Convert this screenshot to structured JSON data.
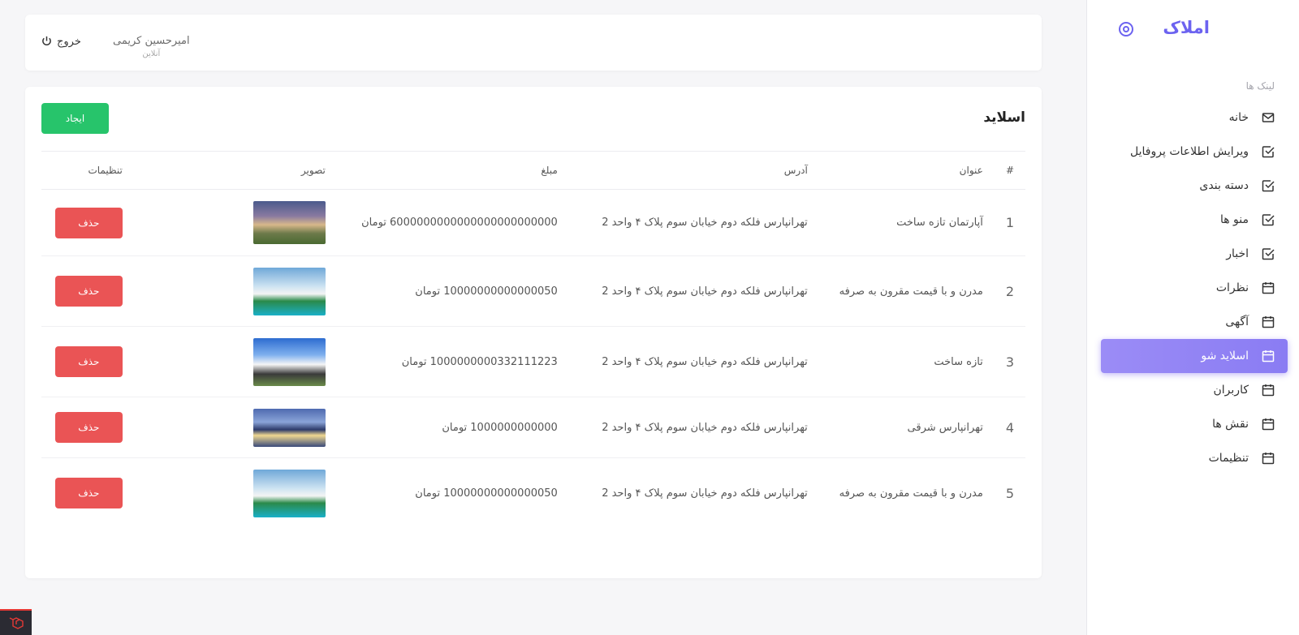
{
  "brand": {
    "title": "املاک"
  },
  "sidebar": {
    "section_label": "لینک ها",
    "items": [
      {
        "label": "خانه",
        "icon": "mail-icon"
      },
      {
        "label": "ویرایش اطلاعات پروفایل",
        "icon": "check-square-icon"
      },
      {
        "label": "دسته بندی",
        "icon": "check-square-icon"
      },
      {
        "label": "منو ها",
        "icon": "check-square-icon"
      },
      {
        "label": "اخبار",
        "icon": "check-square-icon"
      },
      {
        "label": "نظرات",
        "icon": "calendar-icon"
      },
      {
        "label": "آگهی",
        "icon": "calendar-icon"
      },
      {
        "label": "اسلاید شو",
        "icon": "calendar-icon",
        "active": true
      },
      {
        "label": "کاربران",
        "icon": "calendar-icon"
      },
      {
        "label": "نقش ها",
        "icon": "calendar-icon"
      },
      {
        "label": "تنظیمات",
        "icon": "calendar-icon"
      }
    ],
    "active_color": "#8a7cf3"
  },
  "topbar": {
    "logout_label": "خروج",
    "user_name": "امیرحسین کریمی",
    "user_status": "آنلاین"
  },
  "card": {
    "title": "اسلاید",
    "create_label": "ایجاد"
  },
  "table": {
    "headers": [
      "#",
      "عنوان",
      "آدرس",
      "مبلغ",
      "تصویر",
      "تنظیمات"
    ],
    "rows": [
      {
        "num": "1",
        "title": "آپارتمان تازه ساخت",
        "address": "تهرانپارس فلکه دوم خیابان سوم پلاک ۴ واحد 2",
        "price": "6000000000000000000000000 تومان",
        "action": "حذف"
      },
      {
        "num": "2",
        "title": "مدرن و با قیمت مقرون به صرفه",
        "address": "تهرانپارس فلکه دوم خیابان سوم پلاک ۴ واحد 2",
        "price": "10000000000000050 تومان",
        "action": "حذف"
      },
      {
        "num": "3",
        "title": "تازه ساخت",
        "address": "تهرانپارس فلکه دوم خیابان سوم پلاک ۴ واحد 2",
        "price": "1000000000332111223 تومان",
        "action": "حذف"
      },
      {
        "num": "4",
        "title": "تهرانپارس شرقی",
        "address": "تهرانپارس فلکه دوم خیابان سوم پلاک ۴ واحد 2",
        "price": "1000000000000 تومان",
        "action": "حذف"
      },
      {
        "num": "5",
        "title": "مدرن و با قیمت مقرون به صرفه",
        "address": "تهرانپارس فلکه دوم خیابان سوم پلاک ۴ واحد 2",
        "price": "10000000000000050 تومان",
        "action": "حذف"
      }
    ]
  },
  "colors": {
    "brand": "#6c63f0",
    "create_button": "#27c46b",
    "delete_button": "#ea5455"
  }
}
